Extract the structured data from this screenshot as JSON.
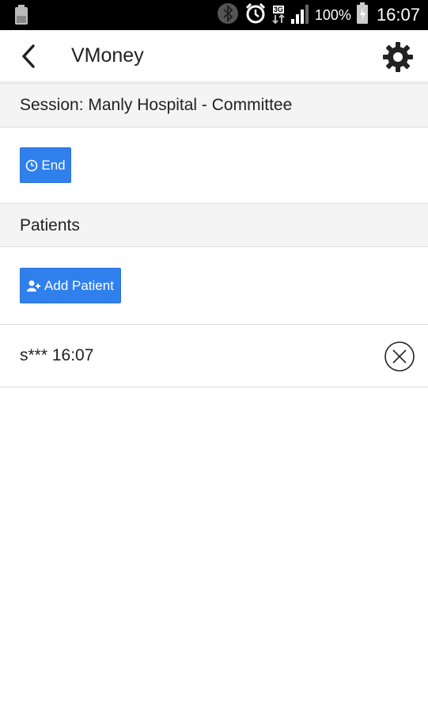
{
  "status_bar": {
    "battery_percent": "100%",
    "time": "16:07",
    "network_label": "3G",
    "battery_level": 1.0,
    "signal_level": 0.75
  },
  "app_bar": {
    "title": "VMoney",
    "back_icon": "chevron-left-icon",
    "settings_icon": "gear-icon"
  },
  "session": {
    "header": "Session: Manly Hospital - Committee",
    "end_button_label": "End",
    "end_button_icon": "clock-icon"
  },
  "patients": {
    "header": "Patients",
    "add_button_label": "Add Patient",
    "add_button_icon": "add-user-icon",
    "items": [
      {
        "label": "s*** 16:07",
        "remove_icon": "close-circle-icon"
      }
    ]
  },
  "colors": {
    "accent": "#2f80ed",
    "section_background": "#f4f4f4",
    "status_bar": "#000000"
  }
}
